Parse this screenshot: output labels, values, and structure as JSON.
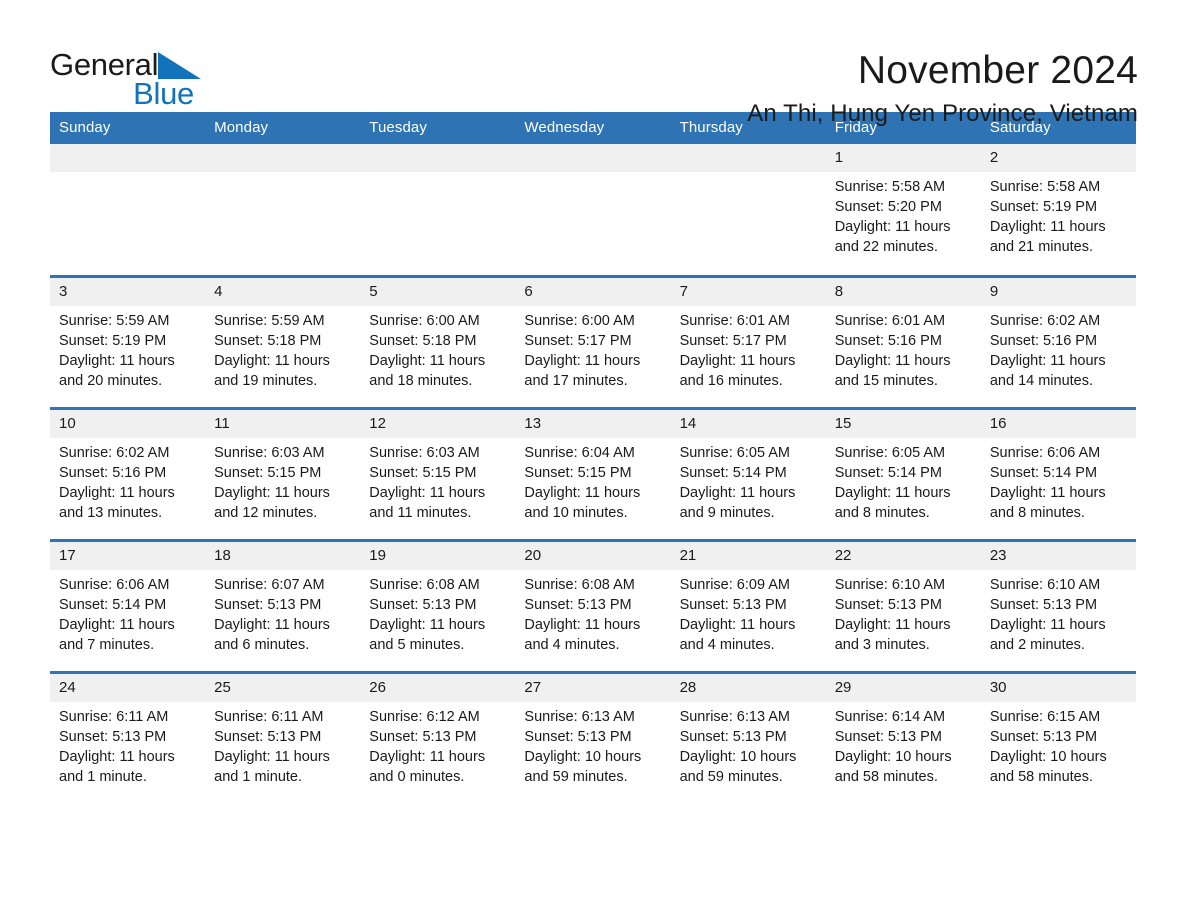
{
  "brand": {
    "name_part1": "General",
    "name_part2": "Blue",
    "triangle_color": "#1272bb",
    "accent_color": "#2e74b5"
  },
  "header": {
    "month_title": "November 2024",
    "location": "An Thi, Hung Yen Province, Vietnam"
  },
  "calendar": {
    "weekday_headers": [
      "Sunday",
      "Monday",
      "Tuesday",
      "Wednesday",
      "Thursday",
      "Friday",
      "Saturday"
    ],
    "labels": {
      "sunrise": "Sunrise:",
      "sunset": "Sunset:",
      "daylight": "Daylight:"
    },
    "weeks": [
      [
        {
          "date": "",
          "sunrise": "",
          "sunset": "",
          "daylight": ""
        },
        {
          "date": "",
          "sunrise": "",
          "sunset": "",
          "daylight": ""
        },
        {
          "date": "",
          "sunrise": "",
          "sunset": "",
          "daylight": ""
        },
        {
          "date": "",
          "sunrise": "",
          "sunset": "",
          "daylight": ""
        },
        {
          "date": "",
          "sunrise": "",
          "sunset": "",
          "daylight": ""
        },
        {
          "date": "1",
          "sunrise": "Sunrise: 5:58 AM",
          "sunset": "Sunset: 5:20 PM",
          "daylight": "Daylight: 11 hours and 22 minutes."
        },
        {
          "date": "2",
          "sunrise": "Sunrise: 5:58 AM",
          "sunset": "Sunset: 5:19 PM",
          "daylight": "Daylight: 11 hours and 21 minutes."
        }
      ],
      [
        {
          "date": "3",
          "sunrise": "Sunrise: 5:59 AM",
          "sunset": "Sunset: 5:19 PM",
          "daylight": "Daylight: 11 hours and 20 minutes."
        },
        {
          "date": "4",
          "sunrise": "Sunrise: 5:59 AM",
          "sunset": "Sunset: 5:18 PM",
          "daylight": "Daylight: 11 hours and 19 minutes."
        },
        {
          "date": "5",
          "sunrise": "Sunrise: 6:00 AM",
          "sunset": "Sunset: 5:18 PM",
          "daylight": "Daylight: 11 hours and 18 minutes."
        },
        {
          "date": "6",
          "sunrise": "Sunrise: 6:00 AM",
          "sunset": "Sunset: 5:17 PM",
          "daylight": "Daylight: 11 hours and 17 minutes."
        },
        {
          "date": "7",
          "sunrise": "Sunrise: 6:01 AM",
          "sunset": "Sunset: 5:17 PM",
          "daylight": "Daylight: 11 hours and 16 minutes."
        },
        {
          "date": "8",
          "sunrise": "Sunrise: 6:01 AM",
          "sunset": "Sunset: 5:16 PM",
          "daylight": "Daylight: 11 hours and 15 minutes."
        },
        {
          "date": "9",
          "sunrise": "Sunrise: 6:02 AM",
          "sunset": "Sunset: 5:16 PM",
          "daylight": "Daylight: 11 hours and 14 minutes."
        }
      ],
      [
        {
          "date": "10",
          "sunrise": "Sunrise: 6:02 AM",
          "sunset": "Sunset: 5:16 PM",
          "daylight": "Daylight: 11 hours and 13 minutes."
        },
        {
          "date": "11",
          "sunrise": "Sunrise: 6:03 AM",
          "sunset": "Sunset: 5:15 PM",
          "daylight": "Daylight: 11 hours and 12 minutes."
        },
        {
          "date": "12",
          "sunrise": "Sunrise: 6:03 AM",
          "sunset": "Sunset: 5:15 PM",
          "daylight": "Daylight: 11 hours and 11 minutes."
        },
        {
          "date": "13",
          "sunrise": "Sunrise: 6:04 AM",
          "sunset": "Sunset: 5:15 PM",
          "daylight": "Daylight: 11 hours and 10 minutes."
        },
        {
          "date": "14",
          "sunrise": "Sunrise: 6:05 AM",
          "sunset": "Sunset: 5:14 PM",
          "daylight": "Daylight: 11 hours and 9 minutes."
        },
        {
          "date": "15",
          "sunrise": "Sunrise: 6:05 AM",
          "sunset": "Sunset: 5:14 PM",
          "daylight": "Daylight: 11 hours and 8 minutes."
        },
        {
          "date": "16",
          "sunrise": "Sunrise: 6:06 AM",
          "sunset": "Sunset: 5:14 PM",
          "daylight": "Daylight: 11 hours and 8 minutes."
        }
      ],
      [
        {
          "date": "17",
          "sunrise": "Sunrise: 6:06 AM",
          "sunset": "Sunset: 5:14 PM",
          "daylight": "Daylight: 11 hours and 7 minutes."
        },
        {
          "date": "18",
          "sunrise": "Sunrise: 6:07 AM",
          "sunset": "Sunset: 5:13 PM",
          "daylight": "Daylight: 11 hours and 6 minutes."
        },
        {
          "date": "19",
          "sunrise": "Sunrise: 6:08 AM",
          "sunset": "Sunset: 5:13 PM",
          "daylight": "Daylight: 11 hours and 5 minutes."
        },
        {
          "date": "20",
          "sunrise": "Sunrise: 6:08 AM",
          "sunset": "Sunset: 5:13 PM",
          "daylight": "Daylight: 11 hours and 4 minutes."
        },
        {
          "date": "21",
          "sunrise": "Sunrise: 6:09 AM",
          "sunset": "Sunset: 5:13 PM",
          "daylight": "Daylight: 11 hours and 4 minutes."
        },
        {
          "date": "22",
          "sunrise": "Sunrise: 6:10 AM",
          "sunset": "Sunset: 5:13 PM",
          "daylight": "Daylight: 11 hours and 3 minutes."
        },
        {
          "date": "23",
          "sunrise": "Sunrise: 6:10 AM",
          "sunset": "Sunset: 5:13 PM",
          "daylight": "Daylight: 11 hours and 2 minutes."
        }
      ],
      [
        {
          "date": "24",
          "sunrise": "Sunrise: 6:11 AM",
          "sunset": "Sunset: 5:13 PM",
          "daylight": "Daylight: 11 hours and 1 minute."
        },
        {
          "date": "25",
          "sunrise": "Sunrise: 6:11 AM",
          "sunset": "Sunset: 5:13 PM",
          "daylight": "Daylight: 11 hours and 1 minute."
        },
        {
          "date": "26",
          "sunrise": "Sunrise: 6:12 AM",
          "sunset": "Sunset: 5:13 PM",
          "daylight": "Daylight: 11 hours and 0 minutes."
        },
        {
          "date": "27",
          "sunrise": "Sunrise: 6:13 AM",
          "sunset": "Sunset: 5:13 PM",
          "daylight": "Daylight: 10 hours and 59 minutes."
        },
        {
          "date": "28",
          "sunrise": "Sunrise: 6:13 AM",
          "sunset": "Sunset: 5:13 PM",
          "daylight": "Daylight: 10 hours and 59 minutes."
        },
        {
          "date": "29",
          "sunrise": "Sunrise: 6:14 AM",
          "sunset": "Sunset: 5:13 PM",
          "daylight": "Daylight: 10 hours and 58 minutes."
        },
        {
          "date": "30",
          "sunrise": "Sunrise: 6:15 AM",
          "sunset": "Sunset: 5:13 PM",
          "daylight": "Daylight: 10 hours and 58 minutes."
        }
      ]
    ]
  }
}
